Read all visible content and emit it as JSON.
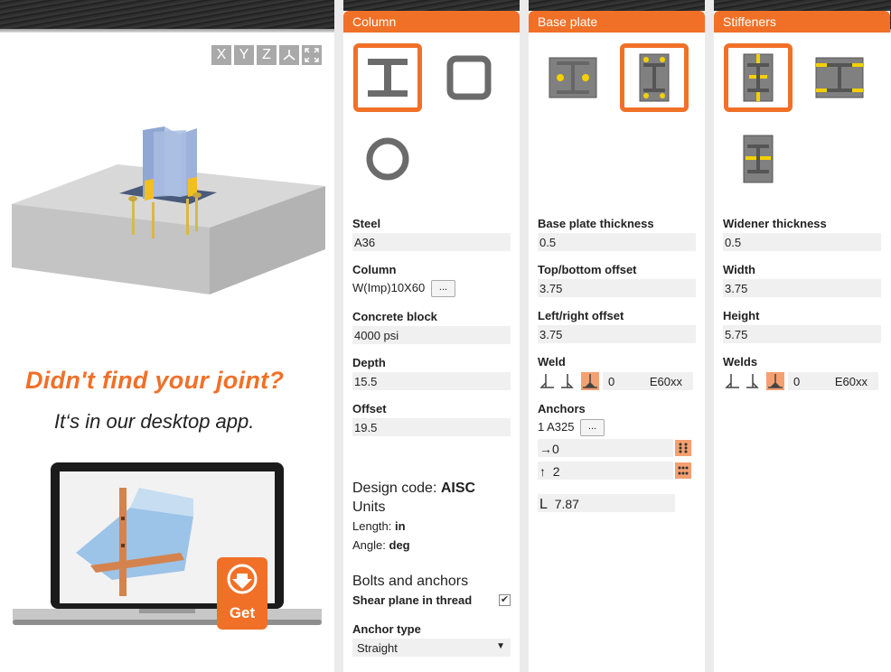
{
  "viewer": {
    "axis_buttons": [
      "X",
      "Y",
      "Z"
    ],
    "iso_icon": "isometric-view-icon",
    "fullscreen_icon": "fullscreen-icon"
  },
  "promo": {
    "title": "Didn't find your joint?",
    "subtitle": "It‘s in our desktop app.",
    "get_label": "Get"
  },
  "column_panel": {
    "header": "Column",
    "steel_label": "Steel",
    "steel_value": "A36",
    "column_label": "Column",
    "column_value": "W(Imp)10X60",
    "column_btn": "...",
    "concrete_label": "Concrete block",
    "concrete_value": "4000 psi",
    "depth_label": "Depth",
    "depth_value": "15.5",
    "offset_label": "Offset",
    "offset_value": "19.5",
    "design_code_label": "Design code:",
    "design_code_value": "AISC",
    "units_label": "Units",
    "length_label": "Length:",
    "length_value": "in",
    "angle_label": "Angle:",
    "angle_value": "deg",
    "bolts_label": "Bolts and anchors",
    "shear_plane_label": "Shear plane in thread",
    "shear_plane_checked": "✔",
    "anchor_type_label": "Anchor type",
    "anchor_type_value": "Straight",
    "dropdown_arrow": "▼"
  },
  "baseplate_panel": {
    "header": "Base plate",
    "thickness_label": "Base plate thickness",
    "thickness_value": "0.5",
    "topbottom_label": "Top/bottom offset",
    "topbottom_value": "3.75",
    "leftright_label": "Left/right offset",
    "leftright_value": "3.75",
    "weld_label": "Weld",
    "weld_size": "0",
    "weld_material": "E60xx",
    "anchors_label": "Anchors",
    "anchors_value": "1 A325",
    "anchors_btn": "...",
    "horiz_prefix": "→",
    "horiz_value": "0",
    "vert_prefix": "↑",
    "vert_value": "2",
    "length_prefix": "L",
    "length_value": "7.87"
  },
  "stiffeners_panel": {
    "header": "Stiffeners",
    "widener_label": "Widener thickness",
    "widener_value": "0.5",
    "width_label": "Width",
    "width_value": "3.75",
    "height_label": "Height",
    "height_value": "5.75",
    "welds_label": "Welds",
    "weld_size": "0",
    "weld_material": "E60xx"
  },
  "colors": {
    "accent": "#f07028",
    "accent_light": "#f4a070",
    "icon_gray": "#6b6b6b",
    "plate_gray": "#808080",
    "bolt_yellow": "#f5d000"
  }
}
